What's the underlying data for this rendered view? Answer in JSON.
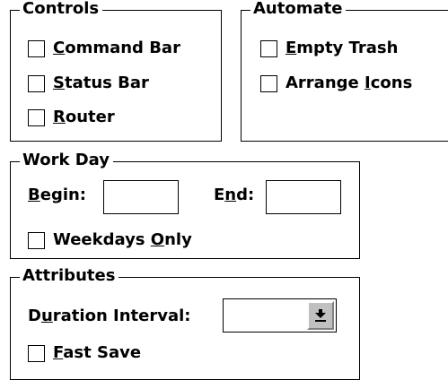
{
  "controls": {
    "title": "Controls",
    "items": [
      {
        "mnemonic": "C",
        "rest": "ommand Bar",
        "checked": false
      },
      {
        "mnemonic": "S",
        "rest": "tatus Bar",
        "checked": false
      },
      {
        "mnemonic": "R",
        "rest": "outer",
        "checked": false
      }
    ]
  },
  "automate": {
    "title": "Automate",
    "items": [
      {
        "before": "",
        "mnemonic": "E",
        "rest": "mpty Trash",
        "checked": false
      },
      {
        "before": "Arrange ",
        "mnemonic": "I",
        "rest": "cons",
        "checked": false
      }
    ]
  },
  "workday": {
    "title": "Work Day",
    "begin": {
      "mnemonic": "B",
      "rest": "egin:",
      "value": ""
    },
    "end": {
      "before": "E",
      "mnemonic": "n",
      "rest": "d:",
      "value": ""
    },
    "weekdays": {
      "before": "Weekdays ",
      "mnemonic": "O",
      "rest": "nly",
      "checked": false
    }
  },
  "attributes": {
    "title": "Attributes",
    "duration": {
      "before": "D",
      "mnemonic": "u",
      "rest": "ration Interval:",
      "value": ""
    },
    "fastsave": {
      "mnemonic": "F",
      "rest": "ast Save",
      "checked": false
    }
  },
  "icons": {
    "dropdown": "arrow-down-to-bar"
  },
  "colors": {
    "background": "#ffffff",
    "button_face": "#c0c0c0",
    "button_shadow": "#808080"
  }
}
